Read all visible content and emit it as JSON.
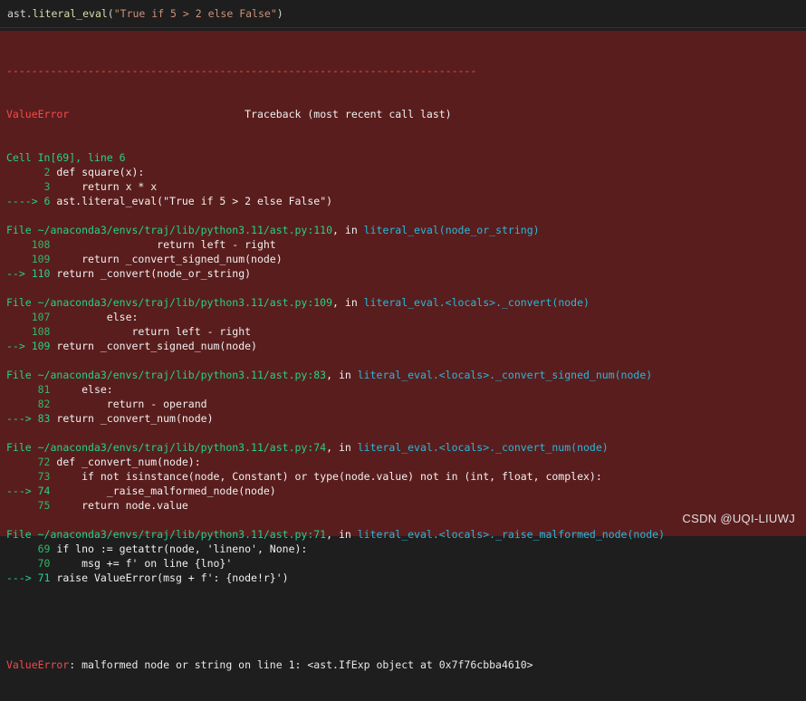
{
  "input": {
    "code_prefix": "ast.",
    "code_fn": "literal_eval",
    "code_open": "(",
    "code_str": "\"True if 5 > 2 else False\"",
    "code_close": ")"
  },
  "traceback": {
    "separator": "---------------------------------------------------------------------------",
    "error_name": "ValueError",
    "header_title": "Traceback (most recent call last)",
    "frames": [
      {
        "location": "Cell In[69], line 6",
        "lines": [
          {
            "arrow": "      ",
            "num": "2",
            "code": " def square(x):"
          },
          {
            "arrow": "      ",
            "num": "3",
            "code": "     return x * x"
          },
          {
            "arrow": "----> ",
            "num": "6",
            "code": " ast.literal_eval(\"True if 5 > 2 else False\")"
          }
        ]
      },
      {
        "location_prefix": "File ",
        "path": "~/anaconda3/envs/traj/lib/python3.11/ast.py:110",
        "in_word": ", in ",
        "func": "literal_eval",
        "args": "(node_or_string)",
        "lines": [
          {
            "arrow": "    ",
            "num": "108",
            "code": "                 return left - right"
          },
          {
            "arrow": "    ",
            "num": "109",
            "code": "     return _convert_signed_num(node)"
          },
          {
            "arrow": "--> ",
            "num": "110",
            "code": " return _convert(node_or_string)"
          }
        ]
      },
      {
        "location_prefix": "File ",
        "path": "~/anaconda3/envs/traj/lib/python3.11/ast.py:109",
        "in_word": ", in ",
        "func": "literal_eval.<locals>._convert",
        "args": "(node)",
        "lines": [
          {
            "arrow": "    ",
            "num": "107",
            "code": "         else:"
          },
          {
            "arrow": "    ",
            "num": "108",
            "code": "             return left - right"
          },
          {
            "arrow": "--> ",
            "num": "109",
            "code": " return _convert_signed_num(node)"
          }
        ]
      },
      {
        "location_prefix": "File ",
        "path": "~/anaconda3/envs/traj/lib/python3.11/ast.py:83",
        "in_word": ", in ",
        "func": "literal_eval.<locals>._convert_signed_num",
        "args": "(node)",
        "lines": [
          {
            "arrow": "     ",
            "num": "81",
            "code": "     else:"
          },
          {
            "arrow": "     ",
            "num": "82",
            "code": "         return - operand"
          },
          {
            "arrow": "---> ",
            "num": "83",
            "code": " return _convert_num(node)"
          }
        ]
      },
      {
        "location_prefix": "File ",
        "path": "~/anaconda3/envs/traj/lib/python3.11/ast.py:74",
        "in_word": ", in ",
        "func": "literal_eval.<locals>._convert_num",
        "args": "(node)",
        "lines": [
          {
            "arrow": "     ",
            "num": "72",
            "code": " def _convert_num(node):"
          },
          {
            "arrow": "     ",
            "num": "73",
            "code": "     if not isinstance(node, Constant) or type(node.value) not in (int, float, complex):"
          },
          {
            "arrow": "---> ",
            "num": "74",
            "code": "         _raise_malformed_node(node)"
          },
          {
            "arrow": "     ",
            "num": "75",
            "code": "     return node.value"
          }
        ]
      },
      {
        "location_prefix": "File ",
        "path": "~/anaconda3/envs/traj/lib/python3.11/ast.py:71",
        "in_word": ", in ",
        "func": "literal_eval.<locals>._raise_malformed_node",
        "args": "(node)",
        "lines": [
          {
            "arrow": "     ",
            "num": "69",
            "code": " if lno := getattr(node, 'lineno', None):"
          },
          {
            "arrow": "     ",
            "num": "70",
            "code": "     msg += f' on line {lno}'"
          },
          {
            "arrow": "---> ",
            "num": "71",
            "code": " raise ValueError(msg + f': {node!r}')"
          }
        ]
      }
    ],
    "final_error_name": "ValueError",
    "final_message": ": malformed node or string on line 1: <ast.IfExp object at 0x7f76cbba4610>"
  },
  "watermark": "CSDN @UQI-LIUWJ",
  "colors": {
    "output_bg": "#5a1d1d",
    "error_red": "#f14c4c",
    "green": "#23d18b",
    "cyan": "#29b8db"
  }
}
